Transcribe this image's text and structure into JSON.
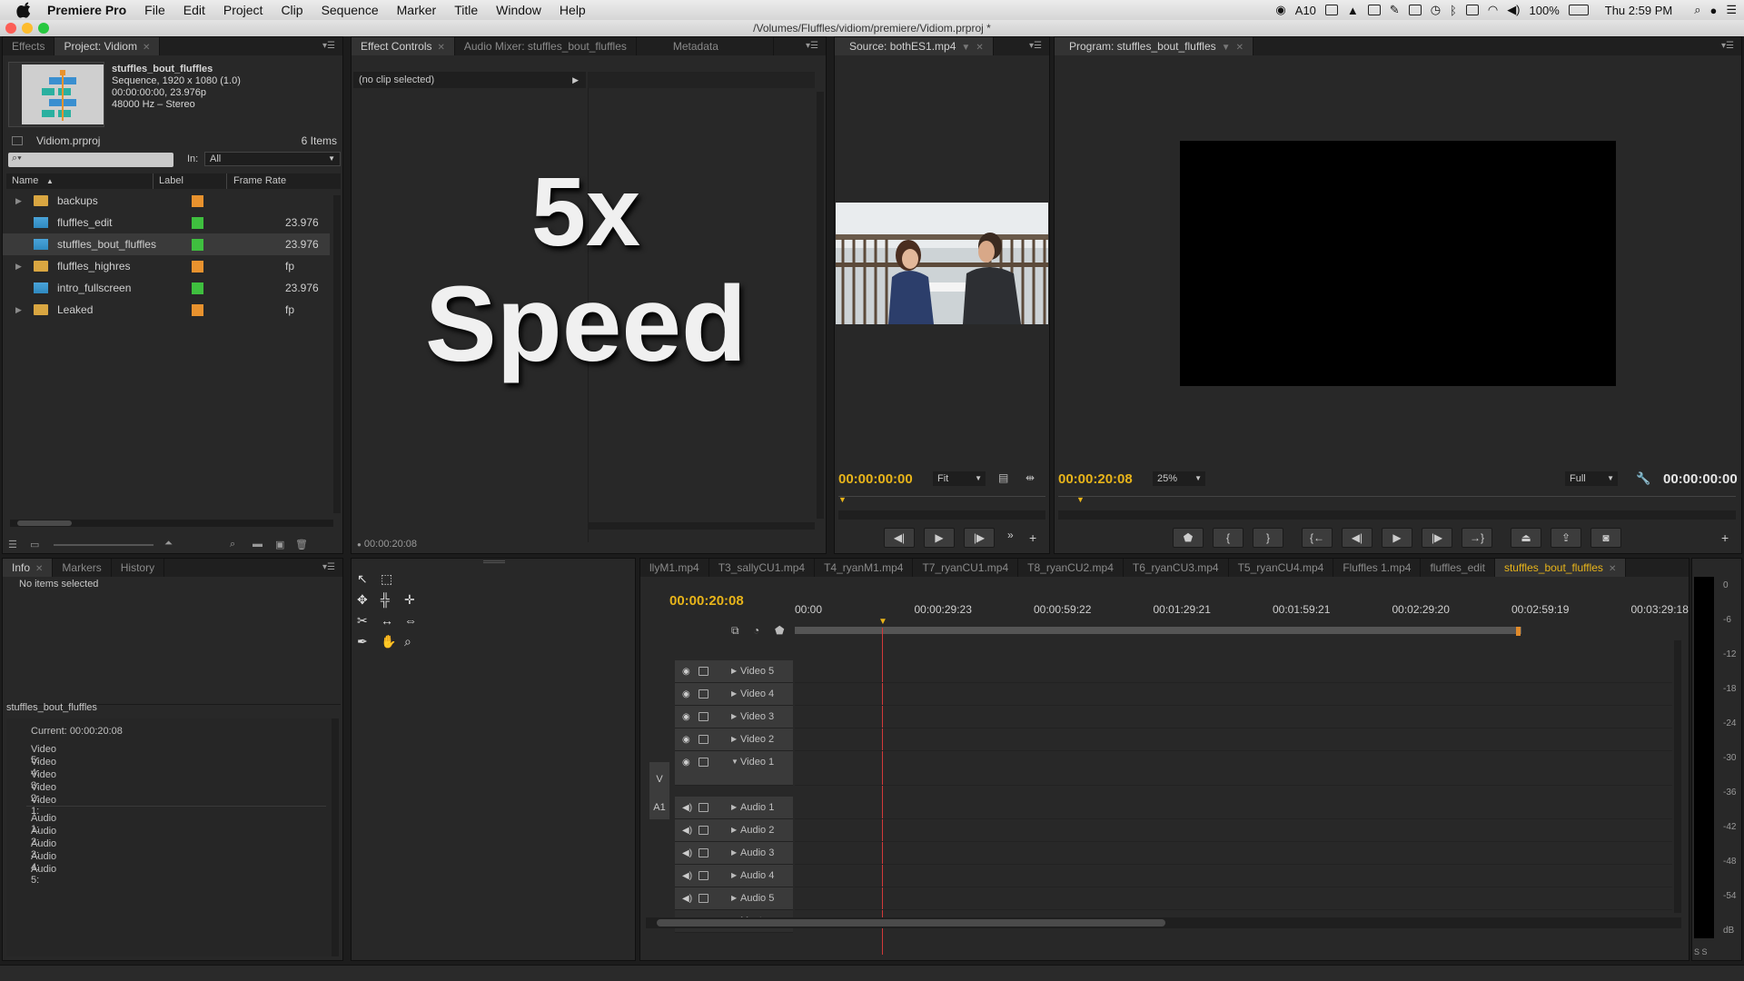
{
  "menubar": {
    "app_name": "Premiere Pro",
    "items": [
      "File",
      "Edit",
      "Project",
      "Clip",
      "Sequence",
      "Marker",
      "Title",
      "Window",
      "Help"
    ],
    "status": {
      "adobe": "10",
      "battery": "100%",
      "clock": "Thu 2:59 PM"
    }
  },
  "window": {
    "title": "/Volumes/Fluffles/vidiom/premiere/Vidiom.prproj *"
  },
  "project_panel": {
    "tabs": [
      "Effects",
      "Project: Vidiom"
    ],
    "preview": {
      "name": "stuffles_bout_fluffles",
      "line1": "Sequence, 1920 x 1080 (1.0)",
      "line2": "00:00:00:00, 23.976p",
      "line3": "48000 Hz – Stereo"
    },
    "project_file": "Vidiom.prproj",
    "item_count": "6 Items",
    "search_placeholder": "",
    "in_label": "In:",
    "in_value": "All",
    "columns": [
      "Name",
      "Label",
      "Frame Rate"
    ],
    "rows": [
      {
        "name": "backups",
        "type": "folder",
        "label_color": "#e8922e",
        "frame_rate": ""
      },
      {
        "name": "fluffles_edit",
        "type": "sequence",
        "label_color": "#3fbf3f",
        "frame_rate": "23.976 fp"
      },
      {
        "name": "stuffles_bout_fluffles",
        "type": "sequence",
        "label_color": "#3fbf3f",
        "frame_rate": "23.976 fp"
      },
      {
        "name": "fluffles_highres",
        "type": "folder",
        "label_color": "#e8922e",
        "frame_rate": ""
      },
      {
        "name": "intro_fullscreen",
        "type": "sequence",
        "label_color": "#3fbf3f",
        "frame_rate": "23.976 fp"
      },
      {
        "name": "Leaked",
        "type": "folder",
        "label_color": "#e8922e",
        "frame_rate": ""
      }
    ]
  },
  "effect_controls": {
    "tabs": [
      "Effect Controls",
      "Audio Mixer: stuffles_bout_fluffles",
      "Metadata"
    ],
    "no_clip": "(no clip selected)",
    "overlay_line1": "5x",
    "overlay_line2": "Speed",
    "timecode": "00:00:20:08"
  },
  "source_monitor": {
    "tab": "Source: bothES1.mp4",
    "timecode": "00:00:00:00",
    "zoom": "Fit"
  },
  "program_monitor": {
    "tab": "Program: stuffles_bout_fluffles",
    "timecode": "00:00:20:08",
    "zoom": "25%",
    "quality": "Full",
    "duration": "00:00:00:00"
  },
  "info_panel": {
    "tabs": [
      "Info",
      "Markers",
      "History"
    ],
    "no_items": "No items selected",
    "sequence_name": "stuffles_bout_fluffles",
    "current_label": "Current:",
    "current_value": "00:00:20:08",
    "video_lines": [
      "Video 5:",
      "Video 4:",
      "Video 3:",
      "Video 2:",
      "Video 1:"
    ],
    "audio_lines": [
      "Audio 1:",
      "Audio 2:",
      "Audio 3:",
      "Audio 4:",
      "Audio 5:"
    ]
  },
  "timeline": {
    "tabs": [
      "llyM1.mp4",
      "T3_sallyCU1.mp4",
      "T4_ryanM1.mp4",
      "T7_ryanCU1.mp4",
      "T8_ryanCU2.mp4",
      "T6_ryanCU3.mp4",
      "T5_ryanCU4.mp4",
      "Fluffles 1.mp4",
      "fluffles_edit",
      "stuffles_bout_fluffles"
    ],
    "timecode": "00:00:20:08",
    "ruler": [
      "00:00",
      "00:00:29:23",
      "00:00:59:22",
      "00:01:29:21",
      "00:01:59:21",
      "00:02:29:20",
      "00:02:59:19",
      "00:03:29:18"
    ],
    "video_tracks": [
      "Video 5",
      "Video 4",
      "Video 3",
      "Video 2",
      "Video 1"
    ],
    "audio_tracks": [
      "Audio 1",
      "Audio 2",
      "Audio 3",
      "Audio 4",
      "Audio 5"
    ],
    "master": "Master",
    "v_target": "V",
    "a_target": "A1"
  },
  "meters": {
    "labels": [
      "0",
      "-6",
      "-12",
      "-18",
      "-24",
      "-30",
      "-36",
      "-42",
      "-48",
      "-54",
      "dB"
    ],
    "buttons": [
      "S",
      "S"
    ]
  }
}
